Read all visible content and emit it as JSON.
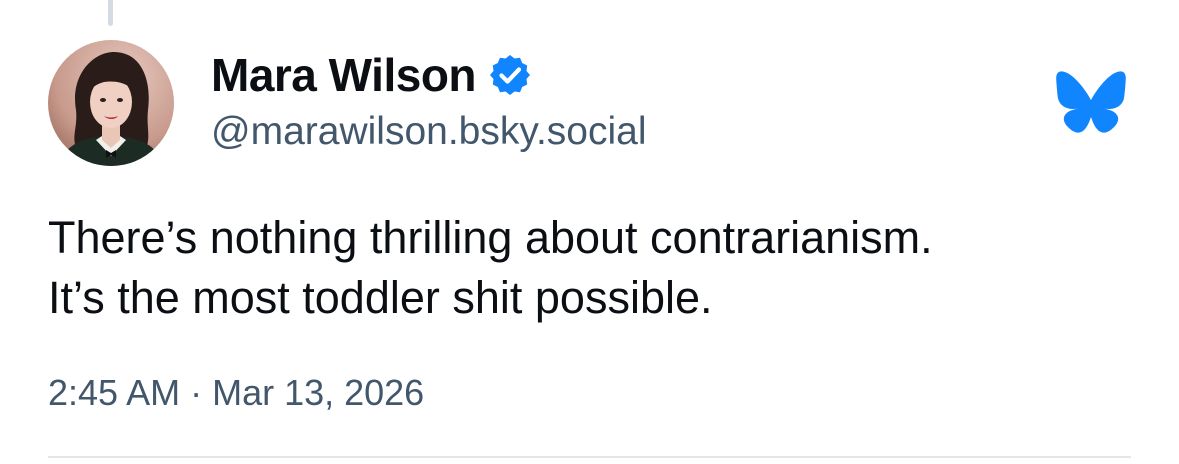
{
  "post": {
    "author": {
      "display_name": "Mara Wilson",
      "handle": "@marawilson.bsky.social",
      "verified": true,
      "verified_icon": "verified-check-icon"
    },
    "text_lines": [
      "There’s nothing thrilling about contrarianism.",
      "It’s the most toddler shit possible."
    ],
    "timestamp": "2:45 AM · Mar 13, 2026"
  },
  "brand": {
    "icon": "bluesky-butterfly-icon",
    "color": "#1185fe"
  },
  "colors": {
    "text_primary": "#0b0f14",
    "text_secondary": "#42576c",
    "verified": "#1185fe",
    "divider": "#e2e7ec"
  }
}
